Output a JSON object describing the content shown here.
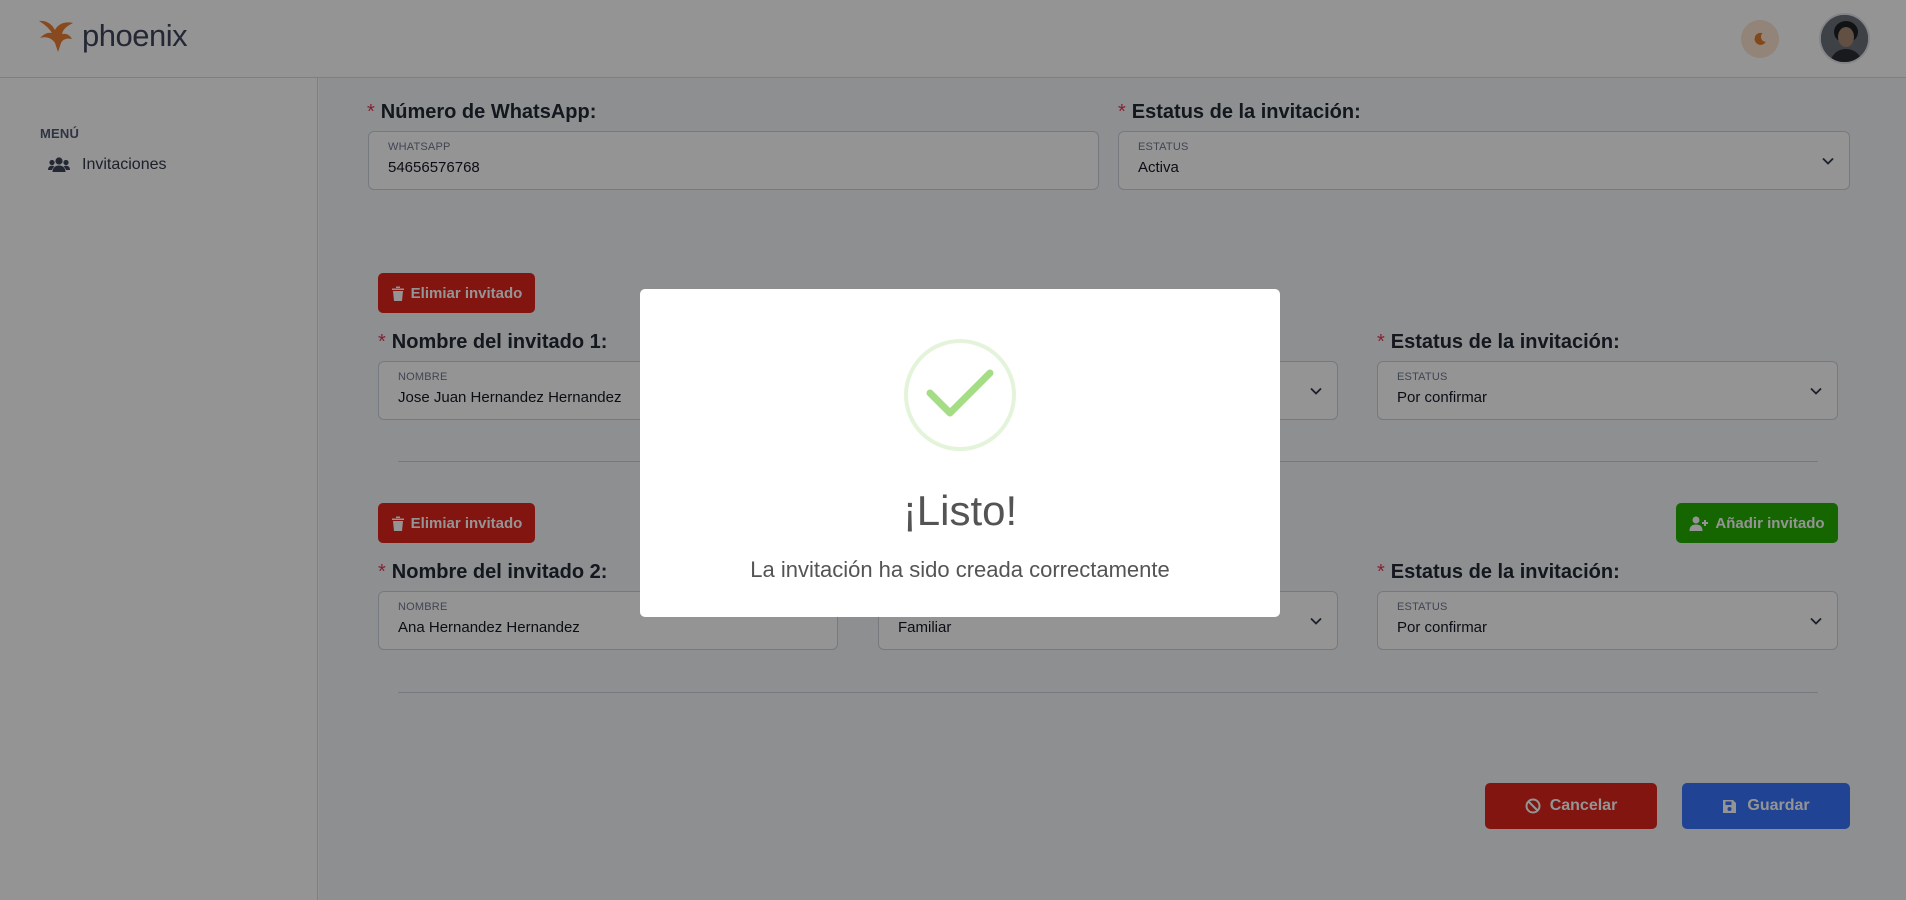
{
  "header": {
    "brand": "phoenix",
    "theme_icon": "moon-icon",
    "avatar_icon": "user-avatar"
  },
  "sidebar": {
    "heading": "MENÚ",
    "items": [
      {
        "label": "Invitaciones",
        "icon": "users-icon"
      }
    ]
  },
  "form": {
    "whatsapp": {
      "label": "Número de WhatsApp:",
      "caption": "WHATSAPP",
      "value": "54656576768"
    },
    "invitation_status": {
      "label": "Estatus de la invitación:",
      "caption": "ESTATUS",
      "value": "Activa"
    },
    "guests": [
      {
        "remove_label": "Elimiar invitado",
        "name_label": "Nombre del invitado 1:",
        "name_caption": "NOMBRE",
        "name_value": "Jose Juan Hernandez Hernandez",
        "status_label": "Estatus de la invitación:",
        "status_caption": "ESTATUS",
        "status_value": "Por confirmar"
      },
      {
        "remove_label": "Elimiar invitado",
        "name_label": "Nombre del invitado 2:",
        "name_caption": "NOMBRE",
        "name_value": "Ana Hernandez Hernandez",
        "type_value": "Familiar",
        "status_label": "Estatus de la invitación:",
        "status_caption": "ESTATUS",
        "status_value": "Por confirmar"
      }
    ],
    "add_guest_label": "Añadir invitado",
    "cancel_label": "Cancelar",
    "save_label": "Guardar"
  },
  "modal": {
    "icon": "success-check-icon",
    "title": "¡Listo!",
    "message": "La invitación ha sido creada correctamente"
  },
  "colors": {
    "danger": "#e1251b",
    "success": "#25b003",
    "primary": "#3874ff",
    "required": "#e63757",
    "check": "#a5dc86"
  }
}
